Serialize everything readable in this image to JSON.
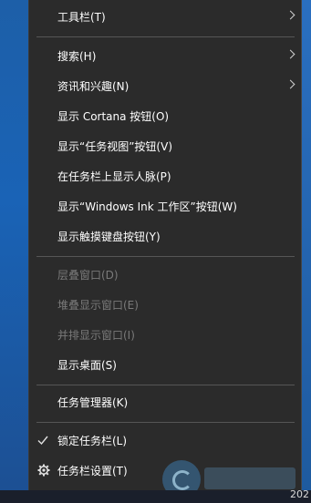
{
  "menu": {
    "items": [
      {
        "label": "工具栏(T)",
        "submenu": true,
        "disabled": false
      },
      {
        "label": "搜索(H)",
        "submenu": true,
        "disabled": false
      },
      {
        "label": "资讯和兴趣(N)",
        "submenu": true,
        "disabled": false
      },
      {
        "label": "显示 Cortana 按钮(O)",
        "submenu": false,
        "disabled": false
      },
      {
        "label": "显示“任务视图”按钮(V)",
        "submenu": false,
        "disabled": false
      },
      {
        "label": "在任务栏上显示人脉(P)",
        "submenu": false,
        "disabled": false
      },
      {
        "label": "显示“Windows Ink 工作区”按钮(W)",
        "submenu": false,
        "disabled": false
      },
      {
        "label": "显示触摸键盘按钮(Y)",
        "submenu": false,
        "disabled": false
      },
      {
        "label": "层叠窗口(D)",
        "submenu": false,
        "disabled": true
      },
      {
        "label": "堆叠显示窗口(E)",
        "submenu": false,
        "disabled": true
      },
      {
        "label": "并排显示窗口(I)",
        "submenu": false,
        "disabled": true
      },
      {
        "label": "显示桌面(S)",
        "submenu": false,
        "disabled": false
      },
      {
        "label": "任务管理器(K)",
        "submenu": false,
        "disabled": false
      },
      {
        "label": "锁定任务栏(L)",
        "submenu": false,
        "disabled": false,
        "checked": true
      },
      {
        "label": "任务栏设置(T)",
        "submenu": false,
        "disabled": false,
        "icon": "gear-icon"
      }
    ]
  },
  "clock": {
    "text": "202"
  },
  "colors": {
    "menu_bg": "#2b2b2b",
    "text": "#ffffff",
    "disabled_text": "#7a7a7a",
    "separator": "#565656"
  }
}
